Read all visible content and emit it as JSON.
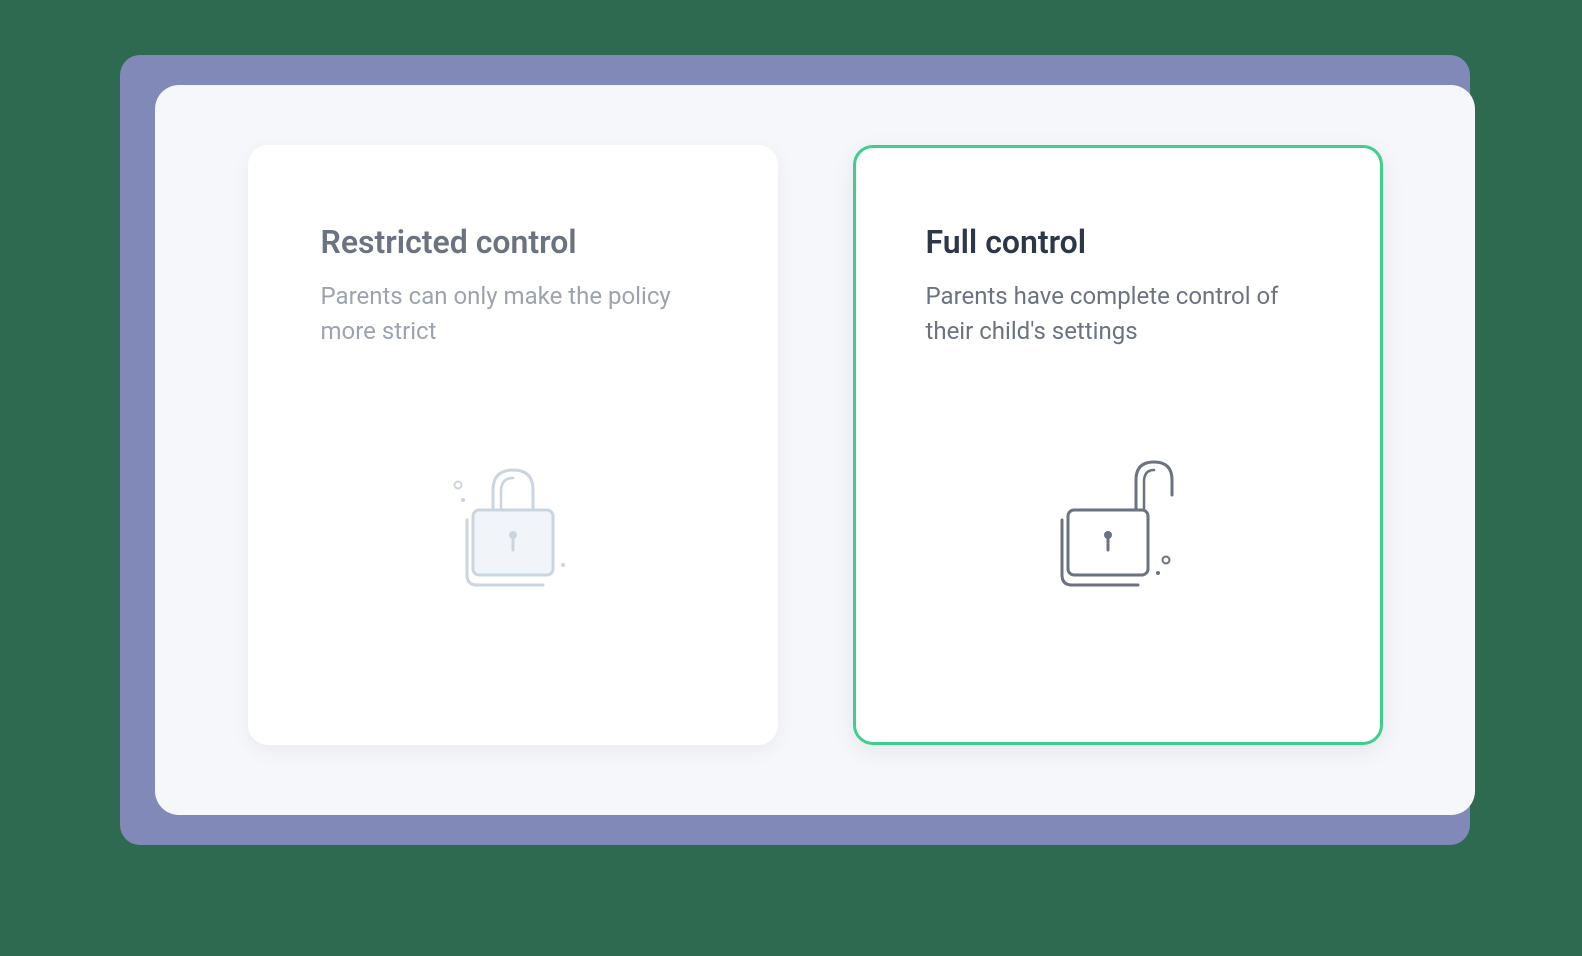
{
  "options": {
    "restricted": {
      "title": "Restricted control",
      "description": "Parents can only make the policy more strict",
      "selected": false
    },
    "full": {
      "title": "Full control",
      "description": "Parents have complete control of their child's settings",
      "selected": true
    }
  },
  "colors": {
    "accent": "#3ecf8e",
    "background": "#2d6a4f",
    "shadow": "#8189b8"
  }
}
